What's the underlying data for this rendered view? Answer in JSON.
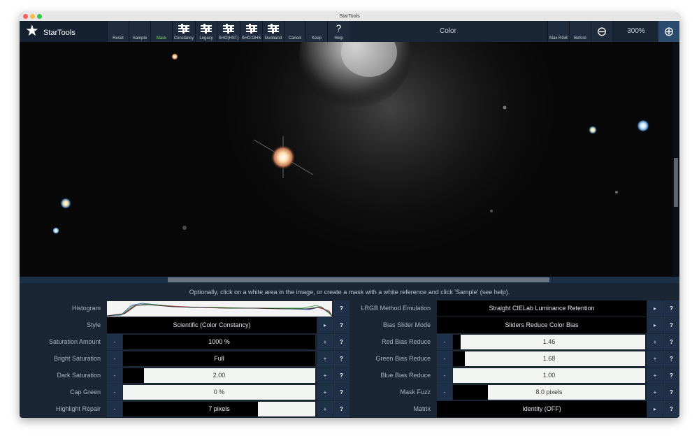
{
  "window": {
    "title": "StarTools"
  },
  "app": {
    "name": "StarTools"
  },
  "toolbar": {
    "buttons": [
      {
        "label": "Reset"
      },
      {
        "label": "Sample"
      },
      {
        "label": "Mask",
        "active": true
      },
      {
        "label": "Constancy",
        "icon": "sliders-icon"
      },
      {
        "label": "Legacy",
        "icon": "sliders-icon"
      },
      {
        "label": "SHO(HST)",
        "icon": "sliders-icon"
      },
      {
        "label": "SHO:OHS",
        "icon": "sliders-icon"
      },
      {
        "label": "Duoband",
        "icon": "sliders-icon"
      },
      {
        "label": "Cancel"
      },
      {
        "label": "Keep"
      },
      {
        "label": "Help",
        "icon": "question-icon"
      }
    ],
    "module_title": "Color",
    "right_buttons": [
      {
        "label": "Max RGB"
      },
      {
        "label": "Before"
      }
    ],
    "zoom_level": "300%"
  },
  "hint": "Optionally, click on a white area in the image, or create a mask with a white reference and click 'Sample' (see help).",
  "colors": {
    "accent": "#1e3148",
    "active_label": "#7be36b",
    "panel": "#1b2635"
  },
  "left_params": [
    {
      "label": "Histogram"
    },
    {
      "label": "Style",
      "value": "Scientific (Color Constancy)"
    },
    {
      "label": "Saturation Amount",
      "value": "1000 %",
      "fraction": 1.0
    },
    {
      "label": "Bright Saturation",
      "value": "Full",
      "fraction": 1.0
    },
    {
      "label": "Dark Saturation",
      "value": "2.00",
      "fraction": 0.11
    },
    {
      "label": "Cap Green",
      "value": "0 %",
      "fraction": 0.0
    },
    {
      "label": "Highlight Repair",
      "value": "7 pixels",
      "fraction": 0.7
    }
  ],
  "right_params": [
    {
      "label": "LRGB Method Emulation",
      "value": "Straight CIELab Luminance Retention"
    },
    {
      "label": "Bias Slider Mode",
      "value": "Sliders Reduce Color Bias"
    },
    {
      "label": "Red Bias Reduce",
      "value": "1.46",
      "fraction": 0.04
    },
    {
      "label": "Green Bias Reduce",
      "value": "1.68",
      "fraction": 0.06
    },
    {
      "label": "Blue Bias Reduce",
      "value": "1.00",
      "fraction": 0.0
    },
    {
      "label": "Mask Fuzz",
      "value": "8.0 pixels",
      "fraction": 0.18
    },
    {
      "label": "Matrix",
      "value": "Identity (OFF)"
    }
  ]
}
